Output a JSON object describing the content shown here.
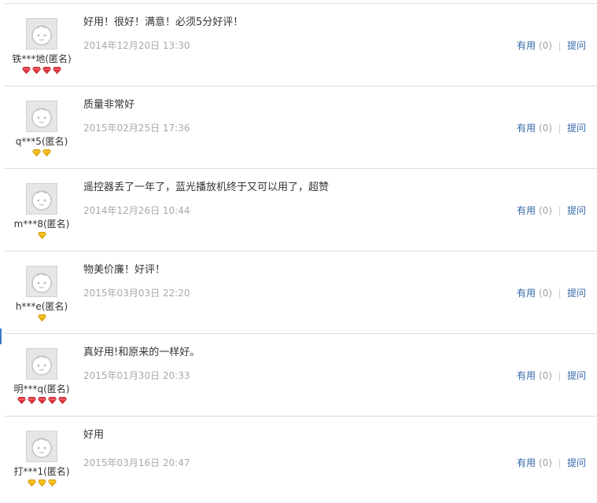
{
  "reviews": [
    {
      "user": "铁***地(匿名)",
      "badge_type": "red-diamond",
      "badge_count": 4,
      "content": "好用！很好！满意！必须5分好评！",
      "date": "2014年12月20日 13:30",
      "useful_label": "有用",
      "useful_count": "(0)",
      "ask_label": "提问"
    },
    {
      "user": "q***5(匿名)",
      "badge_type": "gold-diamond",
      "badge_count": 2,
      "content": "质量非常好",
      "date": "2015年02月25日 17:36",
      "useful_label": "有用",
      "useful_count": "(0)",
      "ask_label": "提问"
    },
    {
      "user": "m***8(匿名)",
      "badge_type": "gold-diamond",
      "badge_count": 1,
      "content": "遥控器丢了一年了，蓝光播放机终于又可以用了，超赞",
      "date": "2014年12月26日 10:44",
      "useful_label": "有用",
      "useful_count": "(0)",
      "ask_label": "提问"
    },
    {
      "user": "h***e(匿名)",
      "badge_type": "gold-diamond",
      "badge_count": 1,
      "content": "物美价廉！好评！",
      "date": "2015年03月03日 22:20",
      "useful_label": "有用",
      "useful_count": "(0)",
      "ask_label": "提问"
    },
    {
      "user": "明***q(匿名)",
      "badge_type": "red-diamond",
      "badge_count": 5,
      "content": "真好用!和原来的一样好。",
      "date": "2015年01月30日 20:33",
      "useful_label": "有用",
      "useful_count": "(0)",
      "ask_label": "提问"
    },
    {
      "user": "打***1(匿名)",
      "badge_type": "gold-diamond",
      "badge_count": 3,
      "content": "好用",
      "date": "2015年03月16日 20:47",
      "useful_label": "有用",
      "useful_count": "(0)",
      "ask_label": "提问"
    }
  ],
  "colors": {
    "link": "#3468a8",
    "date": "#a9a9a9",
    "red_diamond": "#e8323c",
    "gold_diamond": "#f2b600",
    "divider": "#dcdcdc"
  }
}
